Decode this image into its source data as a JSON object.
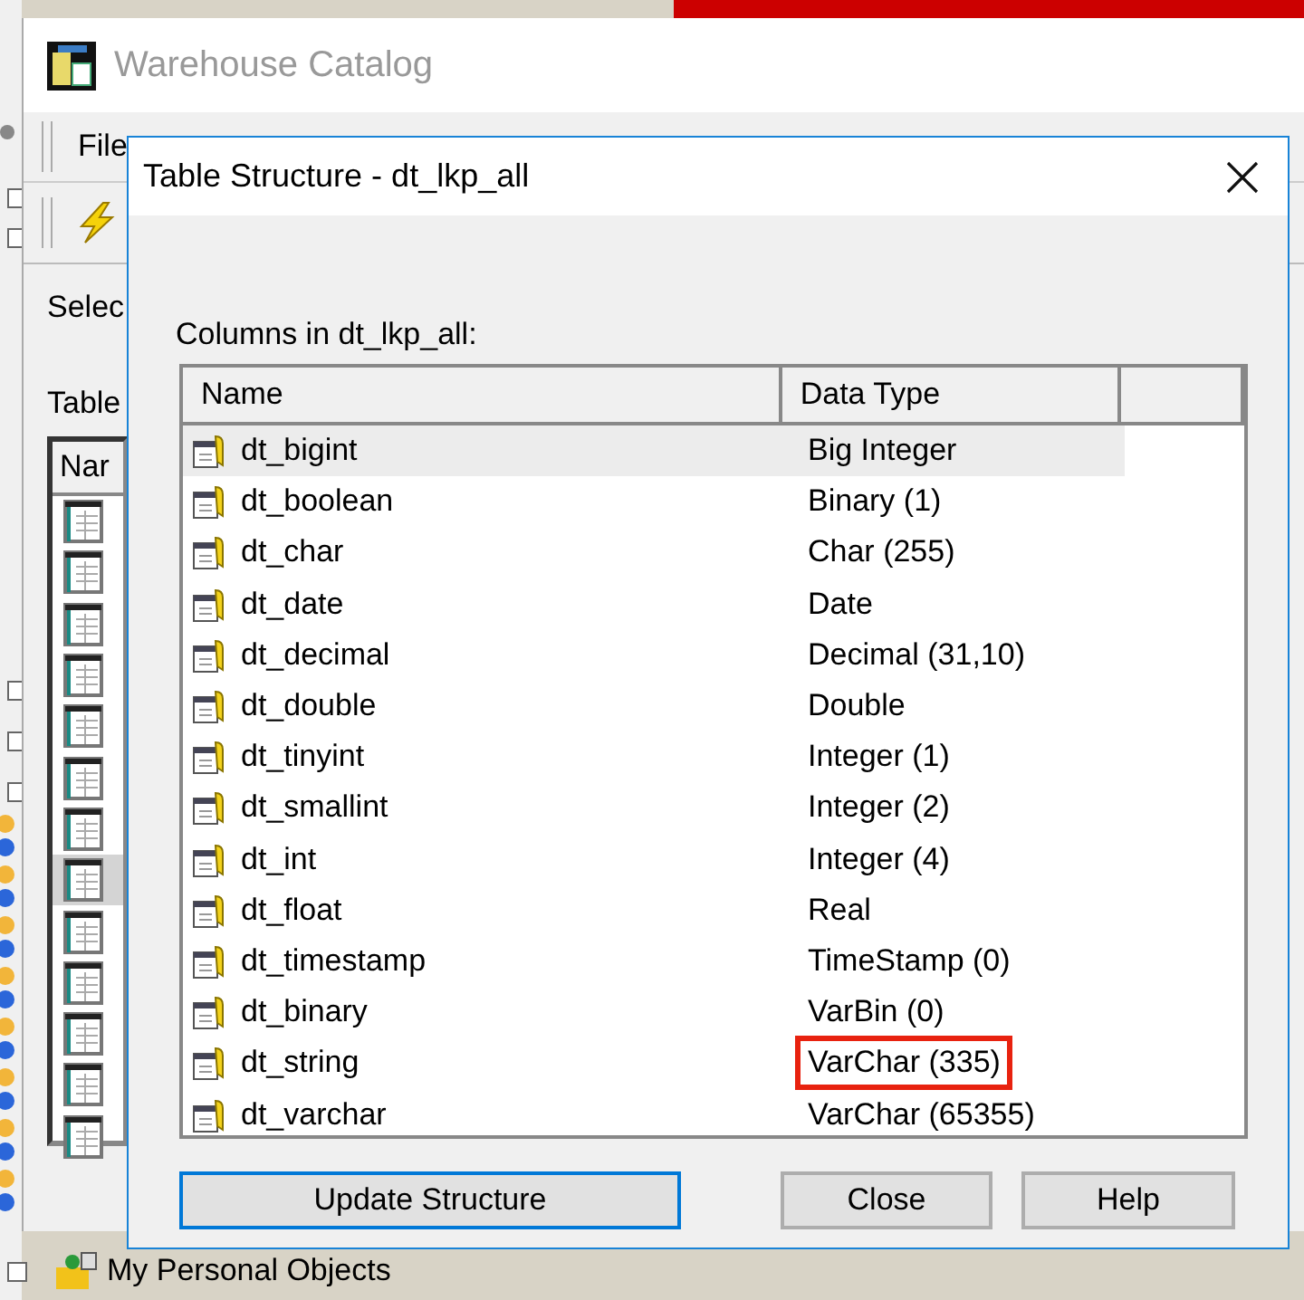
{
  "background": {
    "personal_objects": "My Personal Objects"
  },
  "catalog": {
    "title": "Warehouse Catalog",
    "menu": [
      "File"
    ],
    "select_label": "Selec",
    "tables_label": "Table",
    "list_header": "Nar",
    "list_items": [
      {
        "hovered": false
      },
      {
        "hovered": false
      },
      {
        "hovered": false
      },
      {
        "hovered": false
      },
      {
        "hovered": false
      },
      {
        "hovered": false
      },
      {
        "hovered": false
      },
      {
        "hovered": true
      },
      {
        "hovered": false
      },
      {
        "hovered": false
      },
      {
        "hovered": false
      },
      {
        "hovered": false
      },
      {
        "hovered": false
      }
    ]
  },
  "dialog": {
    "title": "Table Structure - dt_lkp_all",
    "list_label": "Columns in dt_lkp_all:",
    "columns": [
      "Name",
      "Data Type"
    ],
    "rows": [
      {
        "name": "dt_bigint",
        "type": "Big Integer",
        "hovered": true,
        "highlighted": false
      },
      {
        "name": "dt_boolean",
        "type": "Binary (1)",
        "hovered": false,
        "highlighted": false
      },
      {
        "name": "dt_char",
        "type": "Char (255)",
        "hovered": false,
        "highlighted": false
      },
      {
        "name": "dt_date",
        "type": "Date",
        "hovered": false,
        "highlighted": false
      },
      {
        "name": "dt_decimal",
        "type": "Decimal (31,10)",
        "hovered": false,
        "highlighted": false
      },
      {
        "name": "dt_double",
        "type": "Double",
        "hovered": false,
        "highlighted": false
      },
      {
        "name": "dt_tinyint",
        "type": "Integer (1)",
        "hovered": false,
        "highlighted": false
      },
      {
        "name": "dt_smallint",
        "type": "Integer (2)",
        "hovered": false,
        "highlighted": false
      },
      {
        "name": "dt_int",
        "type": "Integer (4)",
        "hovered": false,
        "highlighted": false
      },
      {
        "name": "dt_float",
        "type": "Real",
        "hovered": false,
        "highlighted": false
      },
      {
        "name": "dt_timestamp",
        "type": "TimeStamp (0)",
        "hovered": false,
        "highlighted": false
      },
      {
        "name": "dt_binary",
        "type": "VarBin (0)",
        "hovered": false,
        "highlighted": false
      },
      {
        "name": "dt_string",
        "type": "VarChar (335)",
        "hovered": false,
        "highlighted": true
      },
      {
        "name": "dt_varchar",
        "type": "VarChar (65355)",
        "hovered": false,
        "highlighted": false
      }
    ],
    "buttons": [
      {
        "label": "Update Structure",
        "focused": true
      },
      {
        "label": "Close",
        "focused": false
      },
      {
        "label": "Help",
        "focused": false
      }
    ]
  }
}
